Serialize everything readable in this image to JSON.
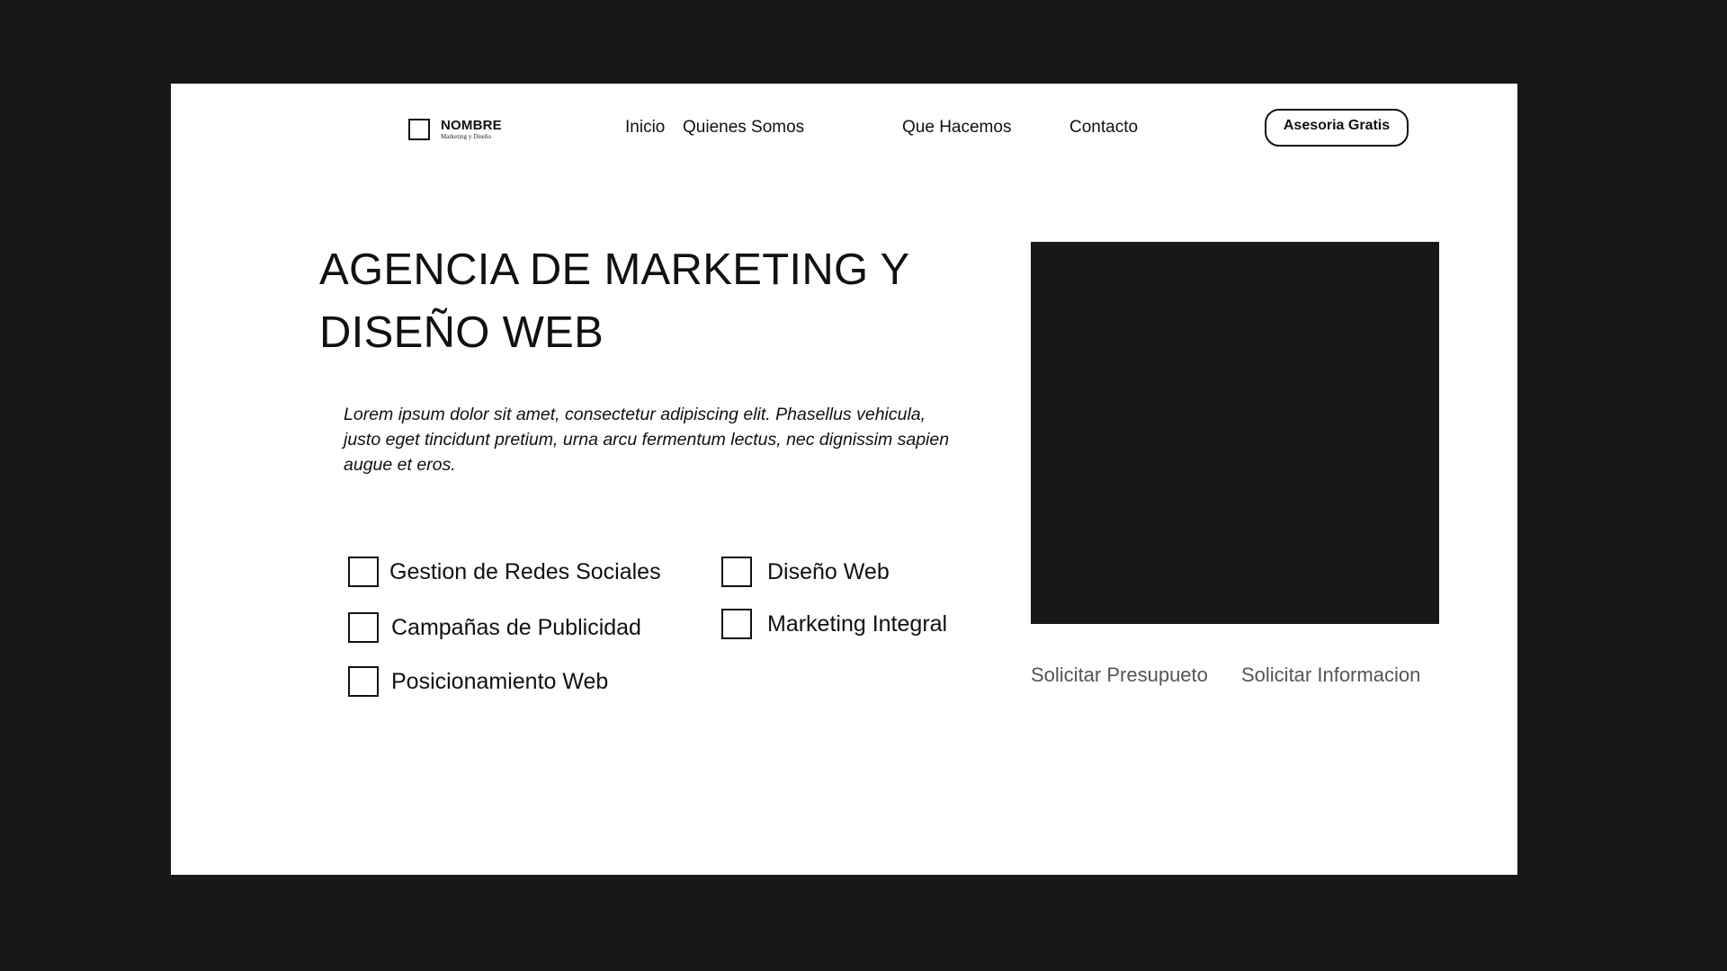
{
  "logo": {
    "name": "NOMBRE",
    "tagline": "Marketing y Diseño"
  },
  "nav": {
    "items": [
      {
        "label": "Inicio"
      },
      {
        "label": "Quienes Somos"
      },
      {
        "label": "Que Hacemos"
      },
      {
        "label": "Contacto"
      }
    ],
    "cta_label": "Asesoria Gratis"
  },
  "hero": {
    "title": "AGENCIA DE MARKETING Y DISEÑO WEB",
    "description": "Lorem ipsum dolor sit amet, consectetur adipiscing elit. Phasellus vehicula, justo eget tincidunt pretium, urna arcu fermentum lectus, nec dignissim sapien augue et eros."
  },
  "services": [
    {
      "label": "Gestion de Redes Sociales",
      "checked": false
    },
    {
      "label": "Campañas de Publicidad",
      "checked": false
    },
    {
      "label": "Posicionamiento Web",
      "checked": false
    },
    {
      "label": "Diseño Web",
      "checked": false
    },
    {
      "label": "Marketing Integral",
      "checked": false
    }
  ],
  "actions": {
    "quote_label": "Solicitar Presupueto",
    "info_label": "Solicitar Informacion"
  },
  "colors": {
    "background": "#191817",
    "surface": "#ffffff",
    "text": "#111111",
    "muted_text": "#555555"
  }
}
